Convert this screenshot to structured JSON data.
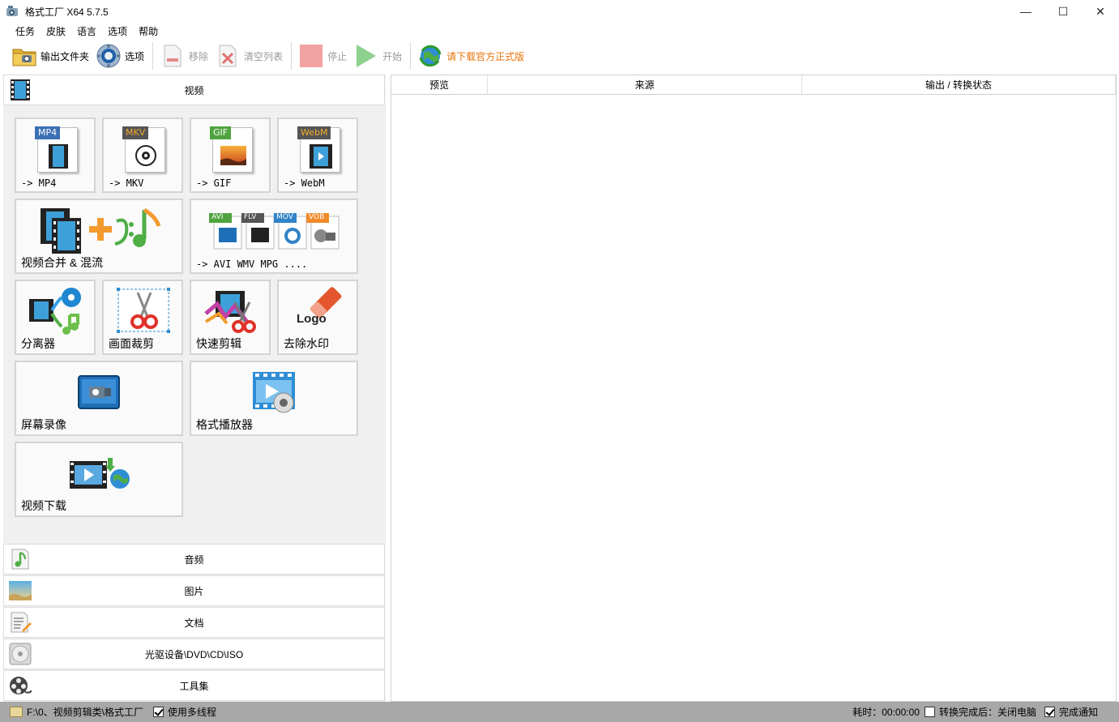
{
  "window": {
    "title": "格式工厂 X64 5.7.5",
    "controls": [
      "—",
      "☐",
      "✕"
    ]
  },
  "menu": [
    "任务",
    "皮肤",
    "语言",
    "选项",
    "帮助"
  ],
  "toolbar": {
    "output_folder": "输出文件夹",
    "options": "选项",
    "remove": "移除",
    "clear_list": "清空列表",
    "stop": "停止",
    "start": "开始",
    "download_official": "请下载官方正式版"
  },
  "categories": {
    "video": "视频",
    "audio": "音频",
    "image": "图片",
    "document": "文档",
    "optical": "光驱设备\\DVD\\CD\\ISO",
    "tools": "工具集"
  },
  "tiles": {
    "mp4": {
      "label": "-> MP4",
      "badge": "MP4"
    },
    "mkv": {
      "label": "-> MKV",
      "badge": "MKV"
    },
    "gif": {
      "label": "-> GIF",
      "badge": "GIF"
    },
    "webm": {
      "label": "-> WebM",
      "badge": "WebM"
    },
    "merge": {
      "label": "视频合并 & 混流"
    },
    "more": {
      "label": "-> AVI WMV MPG ....",
      "badges": [
        "AVI",
        "FLV",
        "MOV",
        "VOB"
      ]
    },
    "splitter": {
      "label": "分离器"
    },
    "crop": {
      "label": "画面裁剪"
    },
    "quick_cut": {
      "label": "快速剪辑"
    },
    "watermark": {
      "label": "去除水印",
      "logo_text": "Logo"
    },
    "screen_record": {
      "label": "屏幕录像"
    },
    "player": {
      "label": "格式播放器"
    },
    "download": {
      "label": "视频下载"
    }
  },
  "table": {
    "columns": [
      "预览",
      "来源",
      "输出 / 转换状态"
    ],
    "rows": []
  },
  "status": {
    "path": "F:\\0、视频剪辑类\\格式工厂",
    "multithread_label": "使用多线程",
    "multithread_checked": true,
    "elapsed": "耗时：00:00:00",
    "after_done_label": "转换完成后：关闭电脑",
    "after_done_checked": false,
    "notify_label": "完成通知",
    "notify_checked": true
  }
}
